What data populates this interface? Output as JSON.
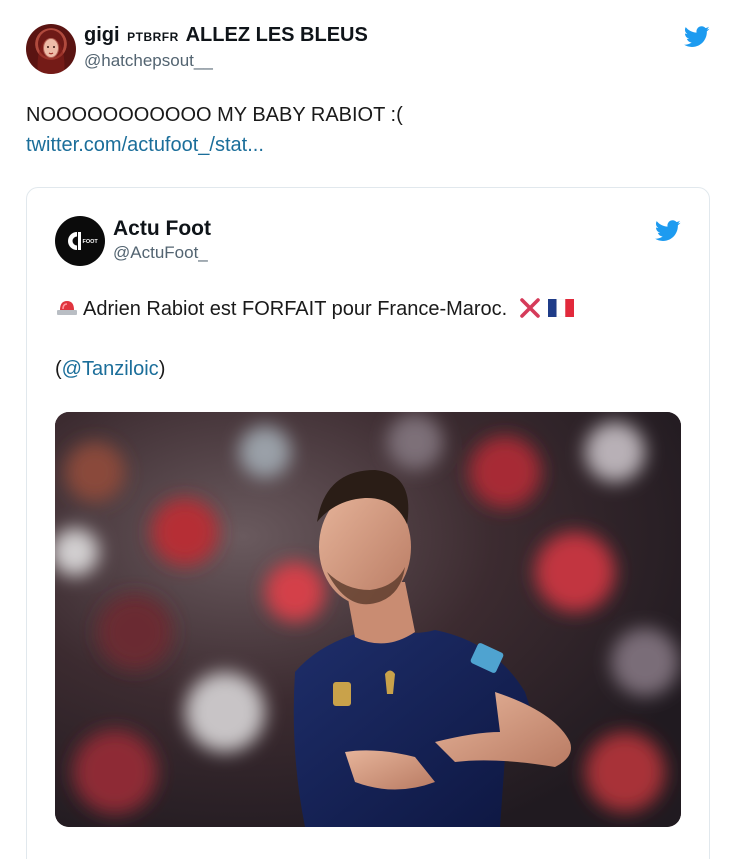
{
  "outer_tweet": {
    "display_name_part1": "gigi",
    "display_name_flags": "PTBRFR",
    "display_name_part2": "ALLEZ LES BLEUS",
    "handle": "@hatchepsout__",
    "text": "NOOOOOOOOOOO MY BABY RABIOT :(",
    "link": "twitter.com/actufoot_/stat..."
  },
  "quoted_tweet": {
    "display_name": "Actu Foot",
    "handle": "@ActuFoot_",
    "avatar_text": "FOOT",
    "text": "Adrien Rabiot est FORFAIT pour France-Maroc.",
    "mention_open": "(",
    "mention": "@Tanziloic",
    "mention_close": ")"
  },
  "icons": {
    "twitter_logo": "twitter-bird-icon",
    "siren": "rotating-light-emoji",
    "cross": "cross-mark-emoji",
    "flag": "france-flag-emoji"
  },
  "colors": {
    "twitter_blue": "#1d9bf0",
    "link": "#1b6e9a",
    "handle_gray": "#536471",
    "cross_red": "#d53b5a"
  }
}
